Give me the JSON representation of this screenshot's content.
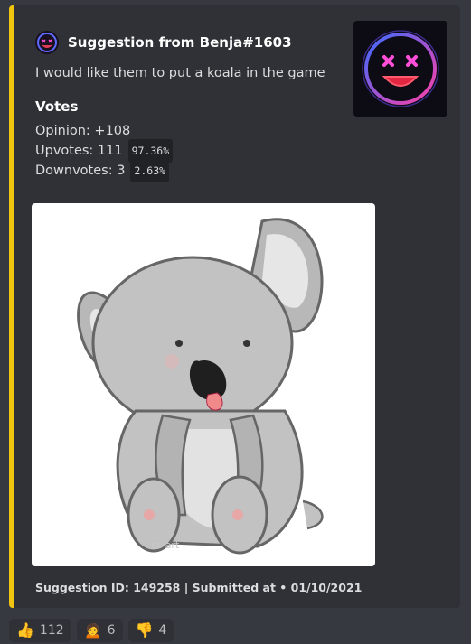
{
  "embed": {
    "accent_color": "#f1c40f",
    "author": "Suggestion from Benja#1603",
    "description": "I would like them to put a koala in the game",
    "field_name": "Votes",
    "opinion": "Opinion: +108",
    "upvotes": "Upvotes: 111",
    "upvotes_pct": "97.36%",
    "downvotes": "Downvotes: 3",
    "downvotes_pct": "2.63%",
    "image_signature": "cc art",
    "footer": "Suggestion ID: 149258 | Submitted at • 01/10/2021"
  },
  "reactions": [
    {
      "icon": "thumbs-up-icon",
      "emoji": "👍",
      "count": "112"
    },
    {
      "icon": "person-emoji-icon",
      "emoji": "🙍",
      "count": "6"
    },
    {
      "icon": "thumbs-down-icon",
      "emoji": "👎",
      "count": "4"
    }
  ]
}
